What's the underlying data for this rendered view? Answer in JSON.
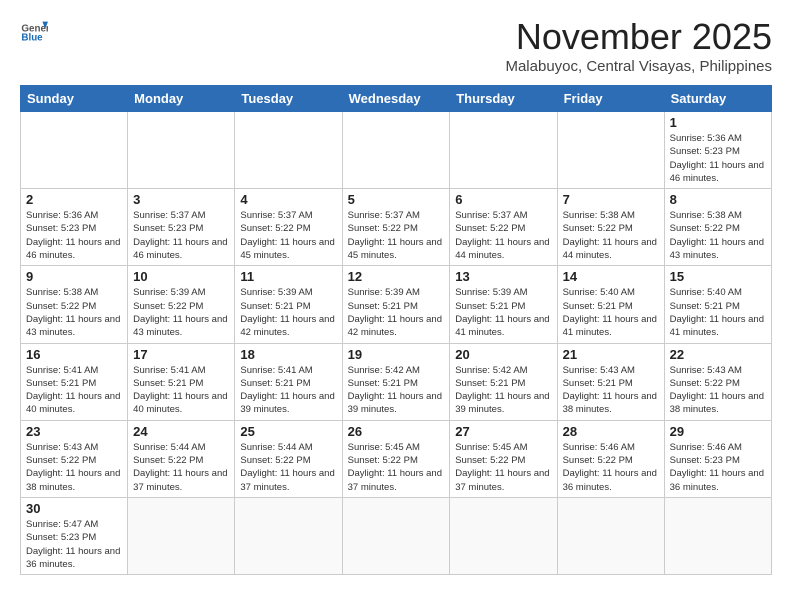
{
  "header": {
    "logo_general": "General",
    "logo_blue": "Blue",
    "month_title": "November 2025",
    "location": "Malabuyoc, Central Visayas, Philippines"
  },
  "weekdays": [
    "Sunday",
    "Monday",
    "Tuesday",
    "Wednesday",
    "Thursday",
    "Friday",
    "Saturday"
  ],
  "weeks": [
    [
      {
        "day": "",
        "info": ""
      },
      {
        "day": "",
        "info": ""
      },
      {
        "day": "",
        "info": ""
      },
      {
        "day": "",
        "info": ""
      },
      {
        "day": "",
        "info": ""
      },
      {
        "day": "",
        "info": ""
      },
      {
        "day": "1",
        "info": "Sunrise: 5:36 AM\nSunset: 5:23 PM\nDaylight: 11 hours and 46 minutes."
      }
    ],
    [
      {
        "day": "2",
        "info": "Sunrise: 5:36 AM\nSunset: 5:23 PM\nDaylight: 11 hours and 46 minutes."
      },
      {
        "day": "3",
        "info": "Sunrise: 5:37 AM\nSunset: 5:23 PM\nDaylight: 11 hours and 46 minutes."
      },
      {
        "day": "4",
        "info": "Sunrise: 5:37 AM\nSunset: 5:22 PM\nDaylight: 11 hours and 45 minutes."
      },
      {
        "day": "5",
        "info": "Sunrise: 5:37 AM\nSunset: 5:22 PM\nDaylight: 11 hours and 45 minutes."
      },
      {
        "day": "6",
        "info": "Sunrise: 5:37 AM\nSunset: 5:22 PM\nDaylight: 11 hours and 44 minutes."
      },
      {
        "day": "7",
        "info": "Sunrise: 5:38 AM\nSunset: 5:22 PM\nDaylight: 11 hours and 44 minutes."
      },
      {
        "day": "8",
        "info": "Sunrise: 5:38 AM\nSunset: 5:22 PM\nDaylight: 11 hours and 43 minutes."
      }
    ],
    [
      {
        "day": "9",
        "info": "Sunrise: 5:38 AM\nSunset: 5:22 PM\nDaylight: 11 hours and 43 minutes."
      },
      {
        "day": "10",
        "info": "Sunrise: 5:39 AM\nSunset: 5:22 PM\nDaylight: 11 hours and 43 minutes."
      },
      {
        "day": "11",
        "info": "Sunrise: 5:39 AM\nSunset: 5:21 PM\nDaylight: 11 hours and 42 minutes."
      },
      {
        "day": "12",
        "info": "Sunrise: 5:39 AM\nSunset: 5:21 PM\nDaylight: 11 hours and 42 minutes."
      },
      {
        "day": "13",
        "info": "Sunrise: 5:39 AM\nSunset: 5:21 PM\nDaylight: 11 hours and 41 minutes."
      },
      {
        "day": "14",
        "info": "Sunrise: 5:40 AM\nSunset: 5:21 PM\nDaylight: 11 hours and 41 minutes."
      },
      {
        "day": "15",
        "info": "Sunrise: 5:40 AM\nSunset: 5:21 PM\nDaylight: 11 hours and 41 minutes."
      }
    ],
    [
      {
        "day": "16",
        "info": "Sunrise: 5:41 AM\nSunset: 5:21 PM\nDaylight: 11 hours and 40 minutes."
      },
      {
        "day": "17",
        "info": "Sunrise: 5:41 AM\nSunset: 5:21 PM\nDaylight: 11 hours and 40 minutes."
      },
      {
        "day": "18",
        "info": "Sunrise: 5:41 AM\nSunset: 5:21 PM\nDaylight: 11 hours and 39 minutes."
      },
      {
        "day": "19",
        "info": "Sunrise: 5:42 AM\nSunset: 5:21 PM\nDaylight: 11 hours and 39 minutes."
      },
      {
        "day": "20",
        "info": "Sunrise: 5:42 AM\nSunset: 5:21 PM\nDaylight: 11 hours and 39 minutes."
      },
      {
        "day": "21",
        "info": "Sunrise: 5:43 AM\nSunset: 5:21 PM\nDaylight: 11 hours and 38 minutes."
      },
      {
        "day": "22",
        "info": "Sunrise: 5:43 AM\nSunset: 5:22 PM\nDaylight: 11 hours and 38 minutes."
      }
    ],
    [
      {
        "day": "23",
        "info": "Sunrise: 5:43 AM\nSunset: 5:22 PM\nDaylight: 11 hours and 38 minutes."
      },
      {
        "day": "24",
        "info": "Sunrise: 5:44 AM\nSunset: 5:22 PM\nDaylight: 11 hours and 37 minutes."
      },
      {
        "day": "25",
        "info": "Sunrise: 5:44 AM\nSunset: 5:22 PM\nDaylight: 11 hours and 37 minutes."
      },
      {
        "day": "26",
        "info": "Sunrise: 5:45 AM\nSunset: 5:22 PM\nDaylight: 11 hours and 37 minutes."
      },
      {
        "day": "27",
        "info": "Sunrise: 5:45 AM\nSunset: 5:22 PM\nDaylight: 11 hours and 37 minutes."
      },
      {
        "day": "28",
        "info": "Sunrise: 5:46 AM\nSunset: 5:22 PM\nDaylight: 11 hours and 36 minutes."
      },
      {
        "day": "29",
        "info": "Sunrise: 5:46 AM\nSunset: 5:23 PM\nDaylight: 11 hours and 36 minutes."
      }
    ],
    [
      {
        "day": "30",
        "info": "Sunrise: 5:47 AM\nSunset: 5:23 PM\nDaylight: 11 hours and 36 minutes."
      },
      {
        "day": "",
        "info": ""
      },
      {
        "day": "",
        "info": ""
      },
      {
        "day": "",
        "info": ""
      },
      {
        "day": "",
        "info": ""
      },
      {
        "day": "",
        "info": ""
      },
      {
        "day": "",
        "info": ""
      }
    ]
  ]
}
